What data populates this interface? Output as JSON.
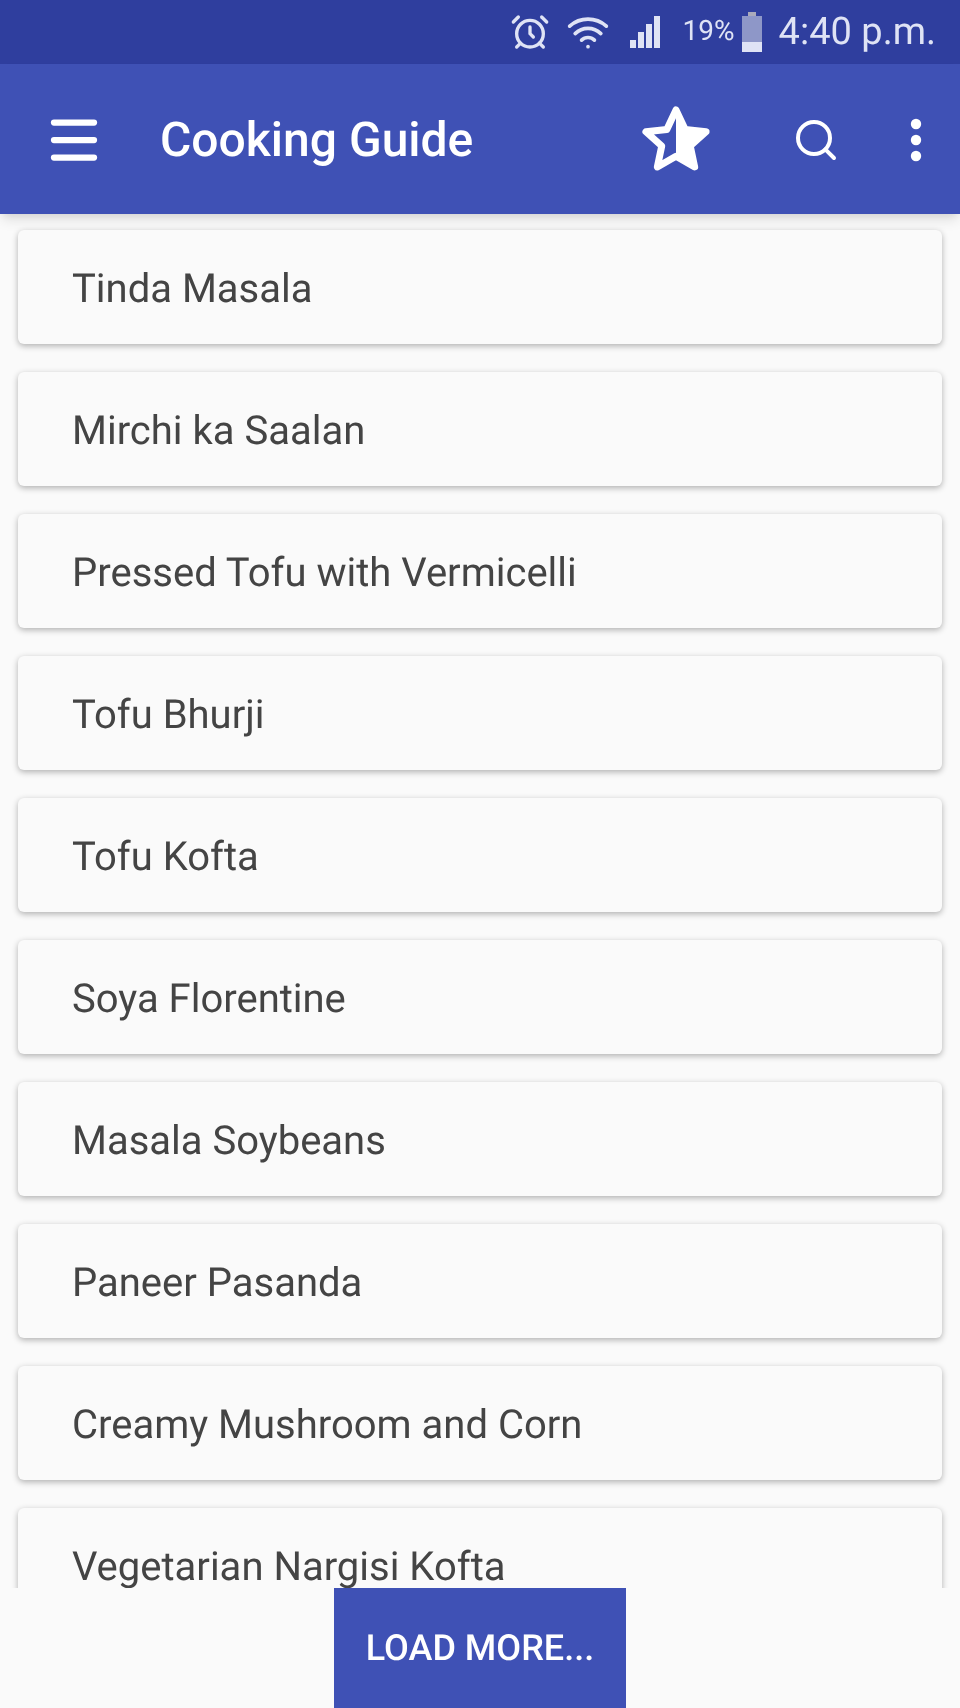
{
  "status_bar": {
    "battery": "19%",
    "time": "4:40 p.m."
  },
  "app_bar": {
    "title": "Cooking Guide"
  },
  "recipes": [
    {
      "name": "Tinda Masala"
    },
    {
      "name": "Mirchi ka Saalan"
    },
    {
      "name": "Pressed Tofu with Vermicelli"
    },
    {
      "name": "Tofu Bhurji"
    },
    {
      "name": "Tofu Kofta"
    },
    {
      "name": "Soya Florentine"
    },
    {
      "name": "Masala Soybeans"
    },
    {
      "name": "Paneer Pasanda"
    },
    {
      "name": "Creamy Mushroom and Corn"
    },
    {
      "name": "Vegetarian Nargisi Kofta"
    }
  ],
  "load_more": {
    "label": "LOAD MORE..."
  }
}
